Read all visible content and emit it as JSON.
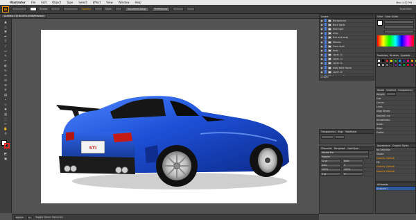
{
  "menubar": {
    "app": "Illustrator",
    "items": [
      "File",
      "Edit",
      "Object",
      "Type",
      "Select",
      "Effect",
      "View",
      "Window",
      "Help"
    ],
    "right": "Mon 1:42 PM"
  },
  "control": {
    "logo": "Ai",
    "label1": "Stroke:",
    "label2": "Opacity:",
    "label3": "Style:",
    "doc_setup": "Document Setup",
    "prefs": "Preferences",
    "workspace": "Essentials"
  },
  "doc_tab": "Untitled-1 @ 66.67% (RGB/Preview)",
  "status": {
    "zoom": "66.67%",
    "page": "1",
    "tool": "Toggle Direct Selection"
  },
  "layers": {
    "title": "Layers",
    "items": [
      "Background",
      "Back lights",
      "Rear light",
      "wing",
      "Rim and body",
      "Wheels",
      "Front shell",
      "body",
      "Layer 12",
      "Layer 13",
      "Layer 11",
      "body back fascia",
      "Layer 10",
      "Drawing Shape"
    ],
    "footer": "1 Layer"
  },
  "color_panel": {
    "tabs": [
      "Color",
      "Color Guide"
    ]
  },
  "swatches_panel": {
    "tabs": [
      "Swatches",
      "Brushes",
      "Symbols"
    ]
  },
  "stroke_panel": {
    "tabs": [
      "Stroke",
      "Gradient",
      "Transparency"
    ],
    "labels": [
      "Weight:",
      "Cap:",
      "Corner:",
      "Limit:",
      "Align Stroke:",
      "Dashed Line",
      "Arrowheads:",
      "Scale:",
      "Align:",
      "Profile:"
    ]
  },
  "transparency_panel": {
    "tabs": [
      "Transparency",
      "Align",
      "Pathfinder"
    ]
  },
  "character_panel": {
    "tabs": [
      "Character",
      "Paragraph",
      "OpenType"
    ],
    "font": "Myriad Pro",
    "style": "Regular",
    "labels": [
      "12 pt",
      "Auto",
      "Auto",
      "0",
      "100%",
      "100%",
      "0 pt",
      "0°"
    ]
  },
  "appearance_panel": {
    "tabs": [
      "Appearance",
      "Graphic Styles"
    ],
    "rows": [
      "No Selection",
      "Stroke:",
      "Opacity: Default",
      "Fill:",
      "Opacity: Default",
      "Opacity: Default"
    ]
  },
  "artboards_panel": {
    "tabs": [
      "Artboards"
    ],
    "item": "Artboard 1"
  },
  "badge": "STI",
  "colors": {
    "accent": "#ff9a00",
    "body": "#1f4fd3",
    "stroke": "#e52521"
  }
}
